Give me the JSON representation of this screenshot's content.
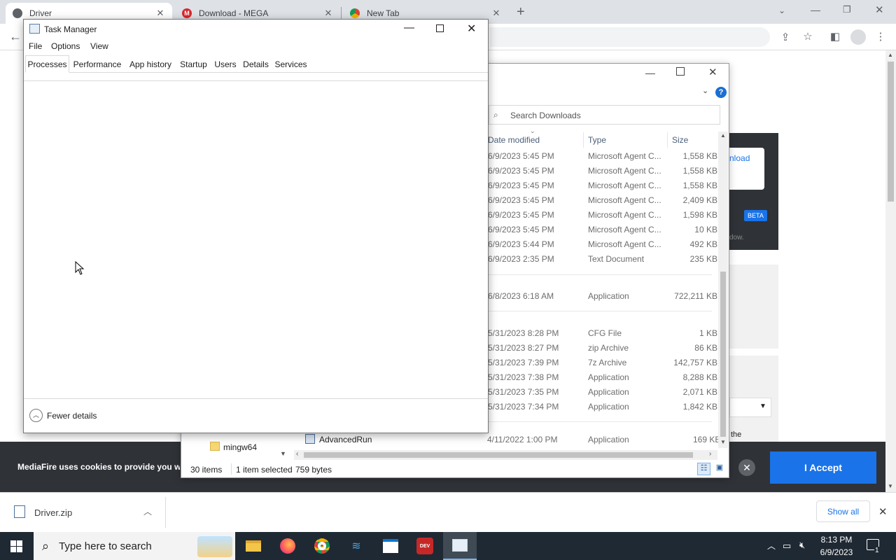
{
  "browser": {
    "tabs": [
      {
        "title": "Driver",
        "icon": "globe-icon"
      },
      {
        "title": "Download - MEGA",
        "icon": "mega-icon"
      },
      {
        "title": "New Tab",
        "icon": "chrome-icon"
      }
    ],
    "new_tab_symbol": "+"
  },
  "page": {
    "cookie_text": "MediaFire uses cookies to provide you w",
    "accept_label": "I Accept",
    "download_label": "nload",
    "beta_label": "BETA",
    "window_text": "dow.",
    "the_text": "the"
  },
  "download_bar": {
    "file_name": "Driver.zip",
    "show_all_label": "Show all"
  },
  "explorer": {
    "search_placeholder": "Search Downloads",
    "columns": {
      "date": "Date modified",
      "type": "Type",
      "size": "Size"
    },
    "rows": [
      {
        "date": "6/9/2023 5:45 PM",
        "type": "Microsoft Agent C...",
        "size": "1,558 KB"
      },
      {
        "date": "6/9/2023 5:45 PM",
        "type": "Microsoft Agent C...",
        "size": "1,558 KB"
      },
      {
        "date": "6/9/2023 5:45 PM",
        "type": "Microsoft Agent C...",
        "size": "1,558 KB"
      },
      {
        "date": "6/9/2023 5:45 PM",
        "type": "Microsoft Agent C...",
        "size": "2,409 KB"
      },
      {
        "date": "6/9/2023 5:45 PM",
        "type": "Microsoft Agent C...",
        "size": "1,598 KB"
      },
      {
        "date": "6/9/2023 5:45 PM",
        "type": "Microsoft Agent C...",
        "size": "10 KB"
      },
      {
        "date": "6/9/2023 5:44 PM",
        "type": "Microsoft Agent C...",
        "size": "492 KB"
      },
      {
        "date": "6/9/2023 2:35 PM",
        "type": "Text Document",
        "size": "235 KB"
      },
      {
        "date": "6/8/2023 6:18 AM",
        "type": "Application",
        "size": "722,211 KB"
      },
      {
        "date": "5/31/2023 8:28 PM",
        "type": "CFG File",
        "size": "1 KB"
      },
      {
        "date": "5/31/2023 8:27 PM",
        "type": "zip Archive",
        "size": "86 KB"
      },
      {
        "date": "5/31/2023 7:39 PM",
        "type": "7z Archive",
        "size": "142,757 KB"
      },
      {
        "date": "5/31/2023 7:38 PM",
        "type": "Application",
        "size": "8,288 KB"
      },
      {
        "date": "5/31/2023 7:35 PM",
        "type": "Application",
        "size": "2,071 KB"
      },
      {
        "date": "5/31/2023 7:34 PM",
        "type": "Application",
        "size": "1,842 KB"
      }
    ],
    "last_row": {
      "name": "AdvancedRun",
      "date": "4/11/2022 1:00 PM",
      "type": "Application",
      "size": "169 KB"
    },
    "nav_item": "mingw64",
    "status": {
      "count": "30 items",
      "selected": "1 item selected",
      "bytes": "759 bytes"
    }
  },
  "task_manager": {
    "title": "Task Manager",
    "menus": [
      "File",
      "Options",
      "View"
    ],
    "tabs": [
      "Processes",
      "Performance",
      "App history",
      "Startup",
      "Users",
      "Details",
      "Services"
    ],
    "active_tab": "Processes",
    "fewer_details_label": "Fewer details"
  },
  "taskbar": {
    "search_placeholder": "Type here to search",
    "time": "8:13 PM",
    "date": "6/9/2023",
    "notification_count": "1",
    "apps": [
      "file-explorer-icon",
      "firefox-icon",
      "chrome-icon",
      "app-icon",
      "store-icon",
      "devcpp-icon",
      "task-manager-icon"
    ]
  },
  "colors": {
    "accent": "#1a73e8",
    "taskbar": "#1f2933",
    "cookie_bar": "#2f3237"
  }
}
